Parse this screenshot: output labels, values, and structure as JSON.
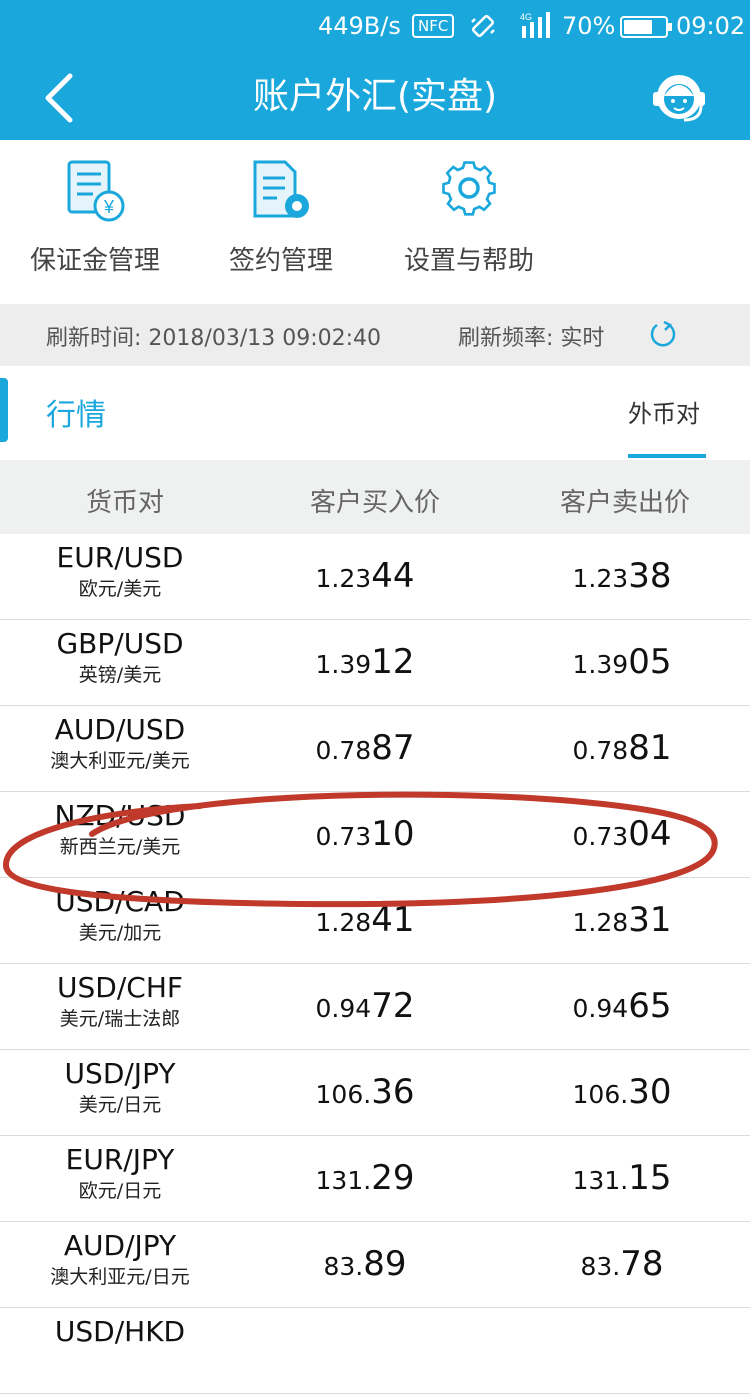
{
  "status_bar": {
    "net_speed": "449B/s",
    "nfc": "NFC",
    "network": "4G",
    "battery_pct": "70%",
    "battery_level": 0.7,
    "time": "09:02"
  },
  "header": {
    "title": "账户外汇(实盘)",
    "back_icon": "chevron-left-icon",
    "support_icon": "customer-service-icon",
    "color": "#1aa8dc"
  },
  "quick_actions": [
    {
      "label": "保证金管理",
      "icon": "margin-document-icon"
    },
    {
      "label": "签约管理",
      "icon": "contract-document-icon"
    },
    {
      "label": "设置与帮助",
      "icon": "gear-icon"
    }
  ],
  "refresh": {
    "time_label": "刷新时间:",
    "time_value": "2018/03/13 09:02:40",
    "freq_label": "刷新频率:",
    "freq_value": "实时",
    "icon": "refresh-icon"
  },
  "tabs": {
    "section_title": "行情",
    "active_tab": "外币对"
  },
  "table": {
    "headers": [
      "货币对",
      "客户买入价",
      "客户卖出价"
    ],
    "rows": [
      {
        "pair": "EUR/USD",
        "name": "欧元/美元",
        "buy_main": "1.23",
        "buy_pips": "44",
        "sell_main": "1.23",
        "sell_pips": "38"
      },
      {
        "pair": "GBP/USD",
        "name": "英镑/美元",
        "buy_main": "1.39",
        "buy_pips": "12",
        "sell_main": "1.39",
        "sell_pips": "05"
      },
      {
        "pair": "AUD/USD",
        "name": "澳大利亚元/美元",
        "buy_main": "0.78",
        "buy_pips": "87",
        "sell_main": "0.78",
        "sell_pips": "81"
      },
      {
        "pair": "NZD/USD",
        "name": "新西兰元/美元",
        "buy_main": "0.73",
        "buy_pips": "10",
        "sell_main": "0.73",
        "sell_pips": "04"
      },
      {
        "pair": "USD/CAD",
        "name": "美元/加元",
        "buy_main": "1.28",
        "buy_pips": "41",
        "sell_main": "1.28",
        "sell_pips": "31"
      },
      {
        "pair": "USD/CHF",
        "name": "美元/瑞士法郎",
        "buy_main": "0.94",
        "buy_pips": "72",
        "sell_main": "0.94",
        "sell_pips": "65"
      },
      {
        "pair": "USD/JPY",
        "name": "美元/日元",
        "buy_main": "106.",
        "buy_pips": "36",
        "sell_main": "106.",
        "sell_pips": "30"
      },
      {
        "pair": "EUR/JPY",
        "name": "欧元/日元",
        "buy_main": "131.",
        "buy_pips": "29",
        "sell_main": "131.",
        "sell_pips": "15"
      },
      {
        "pair": "AUD/JPY",
        "name": "澳大利亚元/日元",
        "buy_main": "83.",
        "buy_pips": "89",
        "sell_main": "83.",
        "sell_pips": "78"
      },
      {
        "pair": "USD/HKD",
        "name": "",
        "buy_main": "",
        "buy_pips": "",
        "sell_main": "",
        "sell_pips": ""
      }
    ]
  },
  "annotation": {
    "color": "#c0392b",
    "highlighted_pair": "NZD/USD"
  }
}
